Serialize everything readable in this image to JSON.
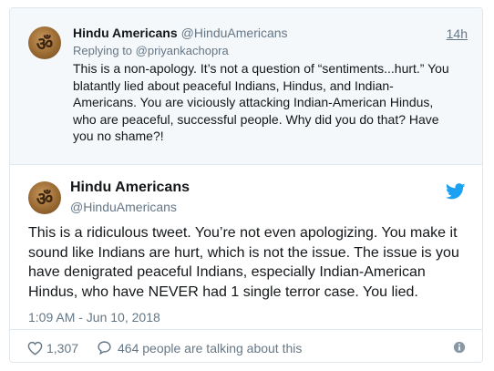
{
  "parent_tweet": {
    "avatar_glyph": "ॐ",
    "display_name": "Hindu Americans",
    "handle": "@HinduAmericans",
    "time": "14h",
    "replying_prefix": "Replying to ",
    "replying_to": "@priyankachopra",
    "text": "This is a non-apology. It’s not a question of “sentiments...hurt.” You blatantly lied about peaceful Indians, Hindus, and Indian-Americans. You are viciously attacking Indian-American Hindus, who are peaceful, successful people. Why did you do that? Have you no shame?!"
  },
  "main_tweet": {
    "avatar_glyph": "ॐ",
    "display_name": "Hindu Americans",
    "handle": "@HinduAmericans",
    "text": "This is a ridiculous tweet. You’re not even apologizing.  You make it sound like Indians are hurt, which is not the issue. The issue is you have denigrated peaceful Indians, especially Indian-American Hindus, who have NEVER had 1 single terror case. You lied.",
    "timestamp": "1:09 AM - Jun 10, 2018",
    "like_count": "1,307",
    "talking_text": "464 people are talking about this"
  },
  "icons": {
    "brand": "twitter-bird-icon",
    "like": "heart-icon",
    "reply": "speech-bubble-icon",
    "info": "info-icon"
  },
  "colors": {
    "brand_blue": "#1da1f2",
    "secondary_text": "#657786",
    "primary_text": "#14171a",
    "parent_bg": "#f5f8fa",
    "border": "#e1e8ed"
  }
}
